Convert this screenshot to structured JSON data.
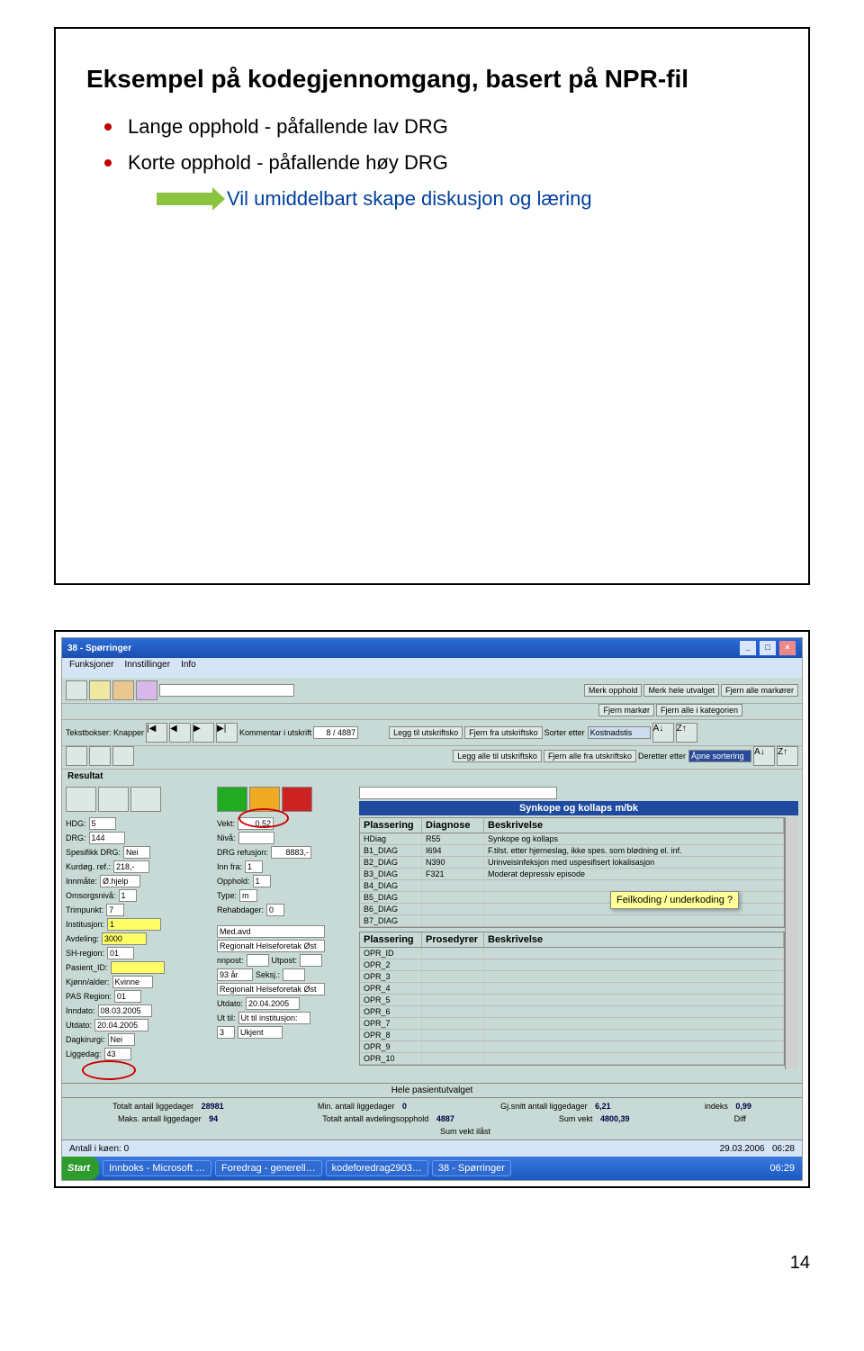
{
  "slide1": {
    "title": "Eksempel på kodegjennomgang, basert på NPR-fil",
    "bullet1": "Lange opphold - påfallende lav DRG",
    "bullet2": "Korte opphold - påfallende høy DRG",
    "arrow_text": "Vil umiddelbart skape diskusjon og læring"
  },
  "app": {
    "title": "38 - Spørringer",
    "menus": [
      "Funksjoner",
      "Innstillinger",
      "Info"
    ],
    "toolbar_btns": {
      "merk_opphold": "Merk opphold",
      "merk_hele": "Merk hele utvalget",
      "fjern_alle": "Fjern alle markører",
      "fjern_marker": "Fjern markør",
      "fjern_alle_kat": "Fjern alle i kategorien",
      "legg_til": "Legg til utskriftsko",
      "fjern_fra": "Fjern fra utskriftsko",
      "legg_alle": "Legg alle til utskriftsko",
      "fjern_alle_fra": "Fjern alle fra utskriftsko",
      "sorter_etter": "Sorter etter",
      "sorter_val": "Kostnadstis",
      "deretter_etter": "Deretter etter",
      "deretter_val": "Åpne sortering",
      "kommentar": "Kommentar i utskrift",
      "tekstbokser": "Tekstbokser: Knapper",
      "counter": "8 / 4887"
    },
    "result_header": "Resultat",
    "blue_title": "Synkope og kollaps m/bk",
    "left": {
      "hdg": {
        "lbl": "HDG:",
        "val": "5"
      },
      "drg": {
        "lbl": "DRG:",
        "val": "144"
      },
      "spesdrg": {
        "lbl": "Spesifikk DRG:",
        "val": "Nei"
      },
      "kurdog": {
        "lbl": "Kurdøg. ref.:",
        "val": "218,-"
      },
      "innmate": {
        "lbl": "Innmåte:",
        "val": "Ø.hjelp"
      },
      "omsniv": {
        "lbl": "Omsorgsnivå:",
        "val": "1"
      },
      "trimp": {
        "lbl": "Trimpunkt:",
        "val": "7"
      },
      "inst": {
        "lbl": "Institusjon:",
        "val": "1"
      },
      "avd": {
        "lbl": "Avdeling:",
        "val": "3000"
      },
      "shreg": {
        "lbl": "SH-region:",
        "val": "01"
      },
      "pasid": {
        "lbl": "Pasient_ID:",
        "val": ""
      },
      "kjonn": {
        "lbl": "Kjønn/alder:",
        "val": "Kvinne"
      },
      "pasreg": {
        "lbl": "PAS Region:",
        "val": "01"
      },
      "inndat": {
        "lbl": "Inndato:",
        "val": "08.03.2005"
      },
      "utdat": {
        "lbl": "Utdato:",
        "val": "20.04.2005"
      },
      "daykir": {
        "lbl": "Dagkirurgi:",
        "val": "Nei"
      },
      "ligged": {
        "lbl": "Liggedag:",
        "val": "43"
      }
    },
    "mid": {
      "vekt": {
        "lbl": "Vekt:",
        "val": "0,52"
      },
      "niva": {
        "lbl": "Nivå:",
        "val": ""
      },
      "drgref": {
        "lbl": "DRG refusjon:",
        "val": "8883,-"
      },
      "innfra": {
        "lbl": "Inn fra:",
        "val": "1"
      },
      "opphold": {
        "lbl": "Opphold:",
        "val": "1"
      },
      "type": {
        "lbl": "Type:",
        "val": "m"
      },
      "rehab": {
        "lbl": "Rehabdager:",
        "val": "0"
      },
      "medavd": {
        "lbl": "Med.avd",
        "val": ""
      },
      "region1": {
        "lbl": "Regionalt Helseforetak Øst",
        "val": ""
      },
      "innpost": {
        "lbl": "nnpost:",
        "utpost": "Utpost:"
      },
      "alder": {
        "lbl": "93 år",
        "seksj": "Seksj.:"
      },
      "region2": {
        "lbl": "Regionalt Helseforetak Øst",
        "val": ""
      },
      "utdato": {
        "lbl": "Utdato:",
        "val": "20.04.2005"
      },
      "uttil": {
        "lbl": "Ut til:",
        "val": "Ut til institusjon:"
      },
      "tre": {
        "lbl": "",
        "val": "3",
        "ukjent": "Ukjent"
      }
    },
    "diag_table": {
      "headers": [
        "Plassering",
        "Diagnose",
        "Beskrivelse"
      ],
      "rows": [
        [
          "HDiag",
          "R55",
          "Synkope og kollaps"
        ],
        [
          "B1_DIAG",
          "I694",
          "F.tilst. etter hjerneslag, ikke spes. som blødning el. inf."
        ],
        [
          "B2_DIAG",
          "N390",
          "Urinveisinfeksjon med uspesifisert lokalisasjon"
        ],
        [
          "B3_DIAG",
          "F321",
          "Moderat depressiv episode"
        ],
        [
          "B4_DIAG",
          "",
          ""
        ],
        [
          "B5_DIAG",
          "",
          ""
        ],
        [
          "B6_DIAG",
          "",
          ""
        ],
        [
          "B7_DIAG",
          "",
          ""
        ]
      ]
    },
    "pros_table": {
      "headers": [
        "Plassering",
        "Prosedyrer",
        "Beskrivelse"
      ],
      "rows": [
        [
          "OPR_ID",
          "",
          ""
        ],
        [
          "OPR_2",
          "",
          ""
        ],
        [
          "OPR_3",
          "",
          ""
        ],
        [
          "OPR_4",
          "",
          ""
        ],
        [
          "OPR_5",
          "",
          ""
        ],
        [
          "OPR_6",
          "",
          ""
        ],
        [
          "OPR_7",
          "",
          ""
        ],
        [
          "OPR_8",
          "",
          ""
        ],
        [
          "OPR_9",
          "",
          ""
        ],
        [
          "OPR_10",
          "",
          ""
        ]
      ]
    },
    "callout": "Feilkoding / underkoding ?",
    "bottom": {
      "hdr": "Hele pasientutvalget",
      "tot_ligge_lbl": "Totalt antall liggedager",
      "tot_ligge": "28981",
      "min_lbl": "Min. antall liggedager",
      "min": "0",
      "gj_lbl": "Gj.snitt antall liggedager",
      "gj": "6,21",
      "indeks_lbl": "indeks",
      "indeks": "0,99",
      "maks_lbl": "Maks. antall liggedager",
      "maks": "94",
      "tot_opp_lbl": "Totalt antall avdelingsopphold",
      "tot_opp": "4887",
      "sumv_lbl": "Sum vekt",
      "sumv": "4800,39",
      "sumvl_lbl": "Sum vekt ilåst",
      "sumvl": "",
      "diff_lbl": "Diff"
    },
    "status": {
      "queue": "Antall i køen: 0",
      "date": "29.03.2006",
      "time": "06:28"
    },
    "taskbar": {
      "start": "Start",
      "items": [
        "Innboks - Microsoft …",
        "Foredrag - generell…",
        "kodeforedrag2903…",
        "38 - Spørringer"
      ],
      "time": "06:29"
    }
  },
  "page_number": "14"
}
